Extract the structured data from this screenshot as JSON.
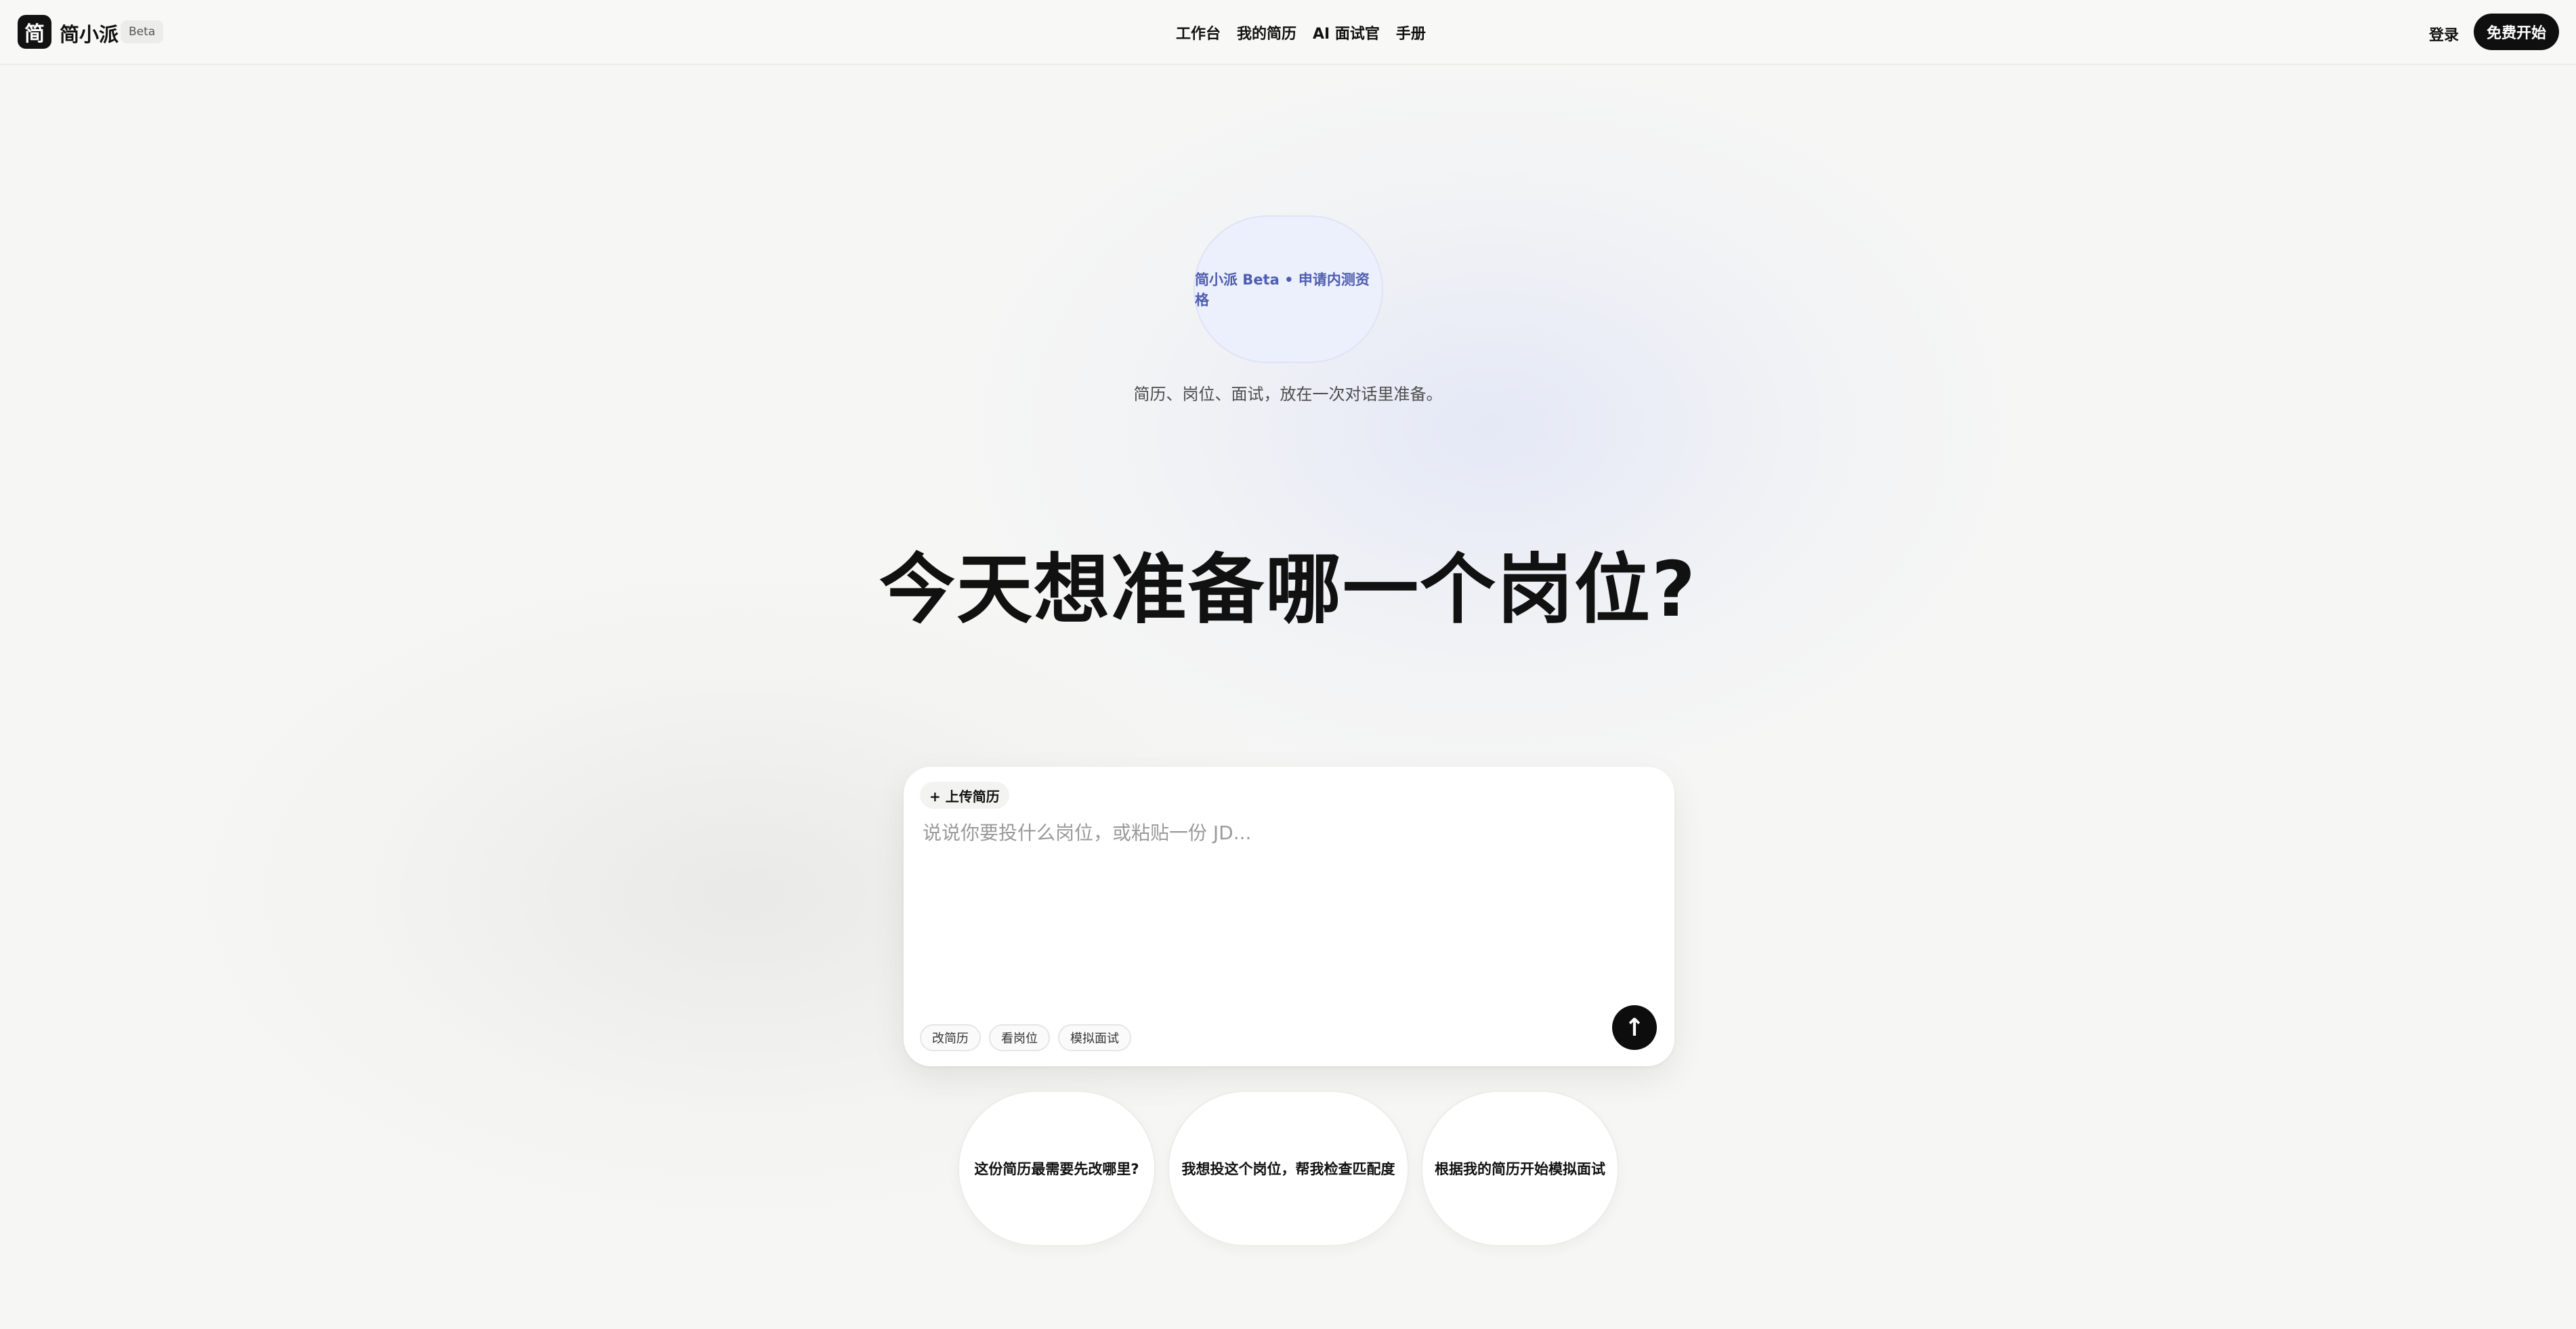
{
  "app": {
    "logo_char": "简",
    "name": "简小派",
    "beta_label": "Beta"
  },
  "nav": {
    "items": [
      "工作台",
      "我的简历",
      "AI 面试官",
      "手册"
    ]
  },
  "header": {
    "login_label": "登录",
    "start_label": "免费开始"
  },
  "hero": {
    "beta_pill": "简小派 Beta • 申请内测资格",
    "subtitle": "简历、岗位、面试，放在一次对话里准备。",
    "headline": "今天想准备哪一个岗位?"
  },
  "composer": {
    "upload_label": "+ 上传简历",
    "placeholder": "说说你要投什么岗位，或粘贴一份 JD...",
    "value": "",
    "chips": [
      "改简历",
      "看岗位",
      "模拟面试"
    ],
    "send_icon": "arrow-up-icon"
  },
  "suggestions": [
    "这份简历最需要先改哪里?",
    "我想投这个岗位，帮我检查匹配度",
    "根据我的简历开始模拟面试"
  ],
  "colors": {
    "accent_dark": "#0f0f0f",
    "pill_bg": "#eceffc",
    "pill_text": "#4d5db0",
    "background": "#f6f6f5"
  }
}
